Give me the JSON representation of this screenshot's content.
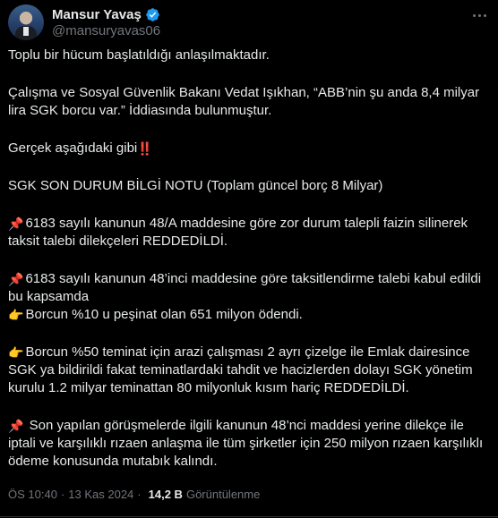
{
  "author": {
    "name": "Mansur Yavaş",
    "handle": "@mansuryavas06",
    "verified_color": "#1d9bf0"
  },
  "tweet": {
    "paragraphs": [
      "Toplu bir hücum başlatıldığı anlaşılmaktadır.",
      "Çalışma ve Sosyal Güvenlik Bakanı Vedat Işıkhan, “ABB’nin şu anda 8,4 milyar lira SGK borcu var.” İddiasında bulunmuştur.",
      "Gerçek aşağıdaki gibi",
      "SGK SON DURUM BİLGİ NOTU (Toplam güncel borç 8 Milyar)",
      "6183 sayılı kanunun 48/A maddesine göre zor durum talepli faizin silinerek taksit talebi dilekçeleri REDDEDİLDİ.",
      "6183 sayılı kanunun 48’inci maddesine göre taksitlendirme talebi kabul edildi bu kapsamda",
      "Borcun %10 u peşinat olan 651 milyon ödendi.",
      "Borcun %50 teminat için arazi çalışması 2 ayrı çizelge ile Emlak dairesince SGK ya bildirildi fakat teminatlardaki tahdit ve hacizlerden dolayı SGK yönetim kurulu 1.2 milyar teminattan 80 milyonluk kısım hariç REDDEDİLDİ.",
      " Son yapılan görüşmelerde ilgili kanunun 48’nci maddesi yerine dilekçe ile iptali ve karşılıklı rızaen anlaşma ile tüm şirketler için 250 milyon rızaen karşılıklı ödeme konusunda mutabık kalındı."
    ],
    "emoji_bangbang": "‼️",
    "emoji_pin": "📌",
    "emoji_hand": "👉"
  },
  "meta": {
    "time": "ÖS 10:40",
    "date": "13 Kas 2024",
    "views_count": "14,2 B",
    "views_label": "Görüntülenme"
  },
  "icons": {
    "verified": "verified-badge-icon",
    "more": "more-horizontal-icon",
    "pin": "pushpin-icon",
    "hand": "pointing-hand-icon",
    "bang": "double-exclamation-icon"
  }
}
